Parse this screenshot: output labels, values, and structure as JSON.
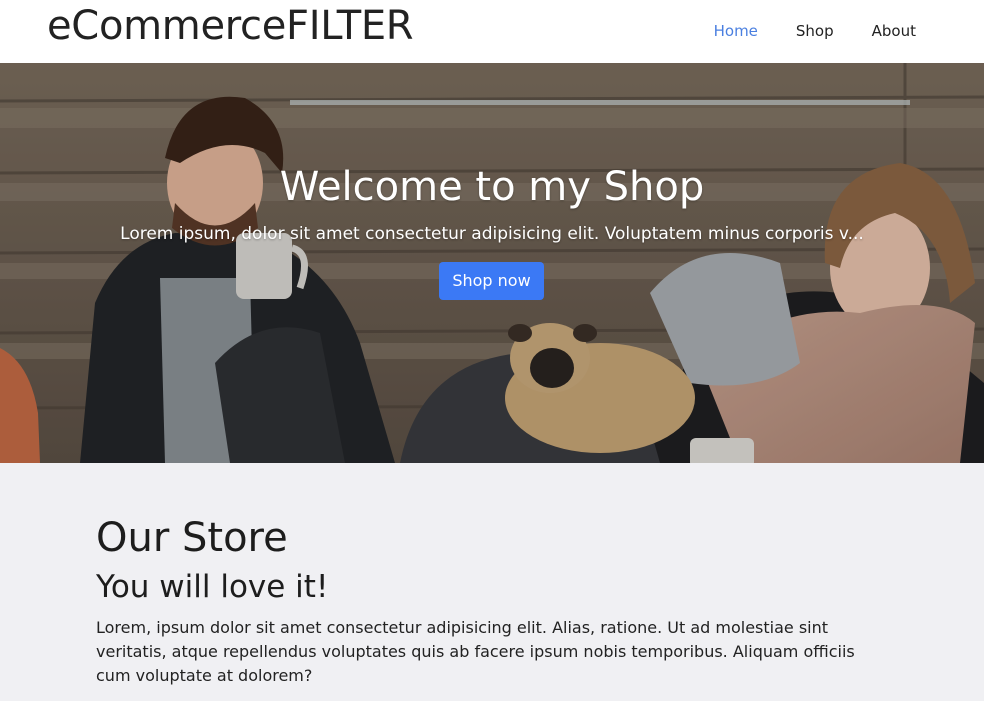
{
  "nav": {
    "brand": "eCommerceFILTER",
    "links": [
      {
        "label": "Home",
        "active": true
      },
      {
        "label": "Shop",
        "active": false
      },
      {
        "label": "About",
        "active": false
      }
    ]
  },
  "hero": {
    "title": "Welcome to my Shop",
    "subtitle": "Lorem ipsum, dolor sit amet consectetur adipisicing elit. Voluptatem minus corporis v...",
    "button_label": "Shop now",
    "image_description_icon": "hero-photo"
  },
  "store": {
    "title": "Our Store",
    "subtitle": "You will love it!",
    "text": "Lorem, ipsum dolor sit amet consectetur adipisicing elit. Alias, ratione. Ut ad molestiae sint veritatis, atque repellendus voluptates quis ab facere ipsum nobis temporibus. Aliquam officiis cum voluptate at dolorem?"
  },
  "colors": {
    "accent": "#3b79f5",
    "active_link": "#4a7fe0",
    "section_bg": "#f0f0f3"
  }
}
